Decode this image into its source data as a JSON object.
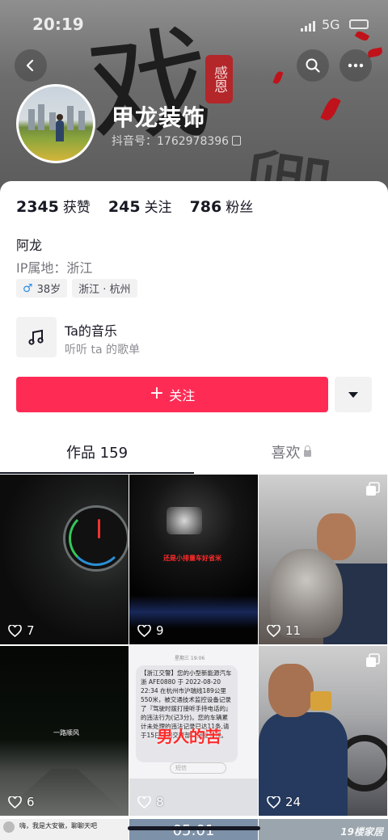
{
  "status": {
    "time": "20:19",
    "network": "5G"
  },
  "cover": {
    "art_char": "戏",
    "seal": "感恩"
  },
  "profile": {
    "nickname": "甲龙装饰",
    "douyin_id_label": "抖音号：",
    "douyin_id": "1762978396"
  },
  "stats": [
    {
      "value": "2345",
      "label": "获赞"
    },
    {
      "value": "245",
      "label": "关注"
    },
    {
      "value": "786",
      "label": "粉丝"
    }
  ],
  "bio": {
    "name": "阿龙",
    "ip_label": "IP属地：",
    "ip_value": "浙江"
  },
  "tags": {
    "gender_symbol": "♂",
    "age": "38岁",
    "location": "浙江 · 杭州"
  },
  "music": {
    "title": "Ta的音乐",
    "subtitle": "听听 ta 的歌单"
  },
  "actions": {
    "follow_label": "关注"
  },
  "tabs": {
    "works": "作品 159",
    "likes": "喜欢"
  },
  "videos": [
    {
      "likes": "7",
      "overlay": ""
    },
    {
      "likes": "9",
      "overlay": "还是小排量车好省米"
    },
    {
      "likes": "11",
      "overlay": ""
    },
    {
      "likes": "6",
      "overlay": "一路顺风"
    },
    {
      "likes": "8",
      "overlay": "男人的苦"
    },
    {
      "likes": "24",
      "overlay": ""
    }
  ],
  "sms": {
    "header": "星期三 19:06",
    "body": "【浙江交警】您的小型新能源汽车浙 AFE0880 于 2022-08-20 22:34 在杭州市沪瑞线189公里550米，被交通技术监控设备记录了『驾驶时拨打接听手持电话的』的违法行为(记3分)。您的车辆累计未处理的违法记录已达11条,请于15日内到交警部门接受处理。",
    "input_placeholder": "短信"
  },
  "row3": {
    "comment": "嗨，我是大安徽，聊聊天吧",
    "time": "05:01",
    "watermark": "19楼家居"
  }
}
